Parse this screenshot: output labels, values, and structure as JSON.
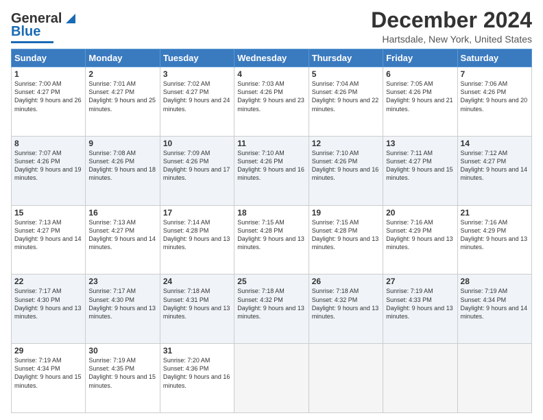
{
  "logo": {
    "line1": "General",
    "line2": "Blue"
  },
  "title": "December 2024",
  "subtitle": "Hartsdale, New York, United States",
  "days_of_week": [
    "Sunday",
    "Monday",
    "Tuesday",
    "Wednesday",
    "Thursday",
    "Friday",
    "Saturday"
  ],
  "weeks": [
    [
      {
        "day": 1,
        "sunrise": "7:00 AM",
        "sunset": "4:27 PM",
        "daylight": "9 hours and 26 minutes."
      },
      {
        "day": 2,
        "sunrise": "7:01 AM",
        "sunset": "4:27 PM",
        "daylight": "9 hours and 25 minutes."
      },
      {
        "day": 3,
        "sunrise": "7:02 AM",
        "sunset": "4:27 PM",
        "daylight": "9 hours and 24 minutes."
      },
      {
        "day": 4,
        "sunrise": "7:03 AM",
        "sunset": "4:26 PM",
        "daylight": "9 hours and 23 minutes."
      },
      {
        "day": 5,
        "sunrise": "7:04 AM",
        "sunset": "4:26 PM",
        "daylight": "9 hours and 22 minutes."
      },
      {
        "day": 6,
        "sunrise": "7:05 AM",
        "sunset": "4:26 PM",
        "daylight": "9 hours and 21 minutes."
      },
      {
        "day": 7,
        "sunrise": "7:06 AM",
        "sunset": "4:26 PM",
        "daylight": "9 hours and 20 minutes."
      }
    ],
    [
      {
        "day": 8,
        "sunrise": "7:07 AM",
        "sunset": "4:26 PM",
        "daylight": "9 hours and 19 minutes."
      },
      {
        "day": 9,
        "sunrise": "7:08 AM",
        "sunset": "4:26 PM",
        "daylight": "9 hours and 18 minutes."
      },
      {
        "day": 10,
        "sunrise": "7:09 AM",
        "sunset": "4:26 PM",
        "daylight": "9 hours and 17 minutes."
      },
      {
        "day": 11,
        "sunrise": "7:10 AM",
        "sunset": "4:26 PM",
        "daylight": "9 hours and 16 minutes."
      },
      {
        "day": 12,
        "sunrise": "7:10 AM",
        "sunset": "4:26 PM",
        "daylight": "9 hours and 16 minutes."
      },
      {
        "day": 13,
        "sunrise": "7:11 AM",
        "sunset": "4:27 PM",
        "daylight": "9 hours and 15 minutes."
      },
      {
        "day": 14,
        "sunrise": "7:12 AM",
        "sunset": "4:27 PM",
        "daylight": "9 hours and 14 minutes."
      }
    ],
    [
      {
        "day": 15,
        "sunrise": "7:13 AM",
        "sunset": "4:27 PM",
        "daylight": "9 hours and 14 minutes."
      },
      {
        "day": 16,
        "sunrise": "7:13 AM",
        "sunset": "4:27 PM",
        "daylight": "9 hours and 14 minutes."
      },
      {
        "day": 17,
        "sunrise": "7:14 AM",
        "sunset": "4:28 PM",
        "daylight": "9 hours and 13 minutes."
      },
      {
        "day": 18,
        "sunrise": "7:15 AM",
        "sunset": "4:28 PM",
        "daylight": "9 hours and 13 minutes."
      },
      {
        "day": 19,
        "sunrise": "7:15 AM",
        "sunset": "4:28 PM",
        "daylight": "9 hours and 13 minutes."
      },
      {
        "day": 20,
        "sunrise": "7:16 AM",
        "sunset": "4:29 PM",
        "daylight": "9 hours and 13 minutes."
      },
      {
        "day": 21,
        "sunrise": "7:16 AM",
        "sunset": "4:29 PM",
        "daylight": "9 hours and 13 minutes."
      }
    ],
    [
      {
        "day": 22,
        "sunrise": "7:17 AM",
        "sunset": "4:30 PM",
        "daylight": "9 hours and 13 minutes."
      },
      {
        "day": 23,
        "sunrise": "7:17 AM",
        "sunset": "4:30 PM",
        "daylight": "9 hours and 13 minutes."
      },
      {
        "day": 24,
        "sunrise": "7:18 AM",
        "sunset": "4:31 PM",
        "daylight": "9 hours and 13 minutes."
      },
      {
        "day": 25,
        "sunrise": "7:18 AM",
        "sunset": "4:32 PM",
        "daylight": "9 hours and 13 minutes."
      },
      {
        "day": 26,
        "sunrise": "7:18 AM",
        "sunset": "4:32 PM",
        "daylight": "9 hours and 13 minutes."
      },
      {
        "day": 27,
        "sunrise": "7:19 AM",
        "sunset": "4:33 PM",
        "daylight": "9 hours and 13 minutes."
      },
      {
        "day": 28,
        "sunrise": "7:19 AM",
        "sunset": "4:34 PM",
        "daylight": "9 hours and 14 minutes."
      }
    ],
    [
      {
        "day": 29,
        "sunrise": "7:19 AM",
        "sunset": "4:34 PM",
        "daylight": "9 hours and 15 minutes."
      },
      {
        "day": 30,
        "sunrise": "7:19 AM",
        "sunset": "4:35 PM",
        "daylight": "9 hours and 15 minutes."
      },
      {
        "day": 31,
        "sunrise": "7:20 AM",
        "sunset": "4:36 PM",
        "daylight": "9 hours and 16 minutes."
      },
      null,
      null,
      null,
      null
    ]
  ]
}
